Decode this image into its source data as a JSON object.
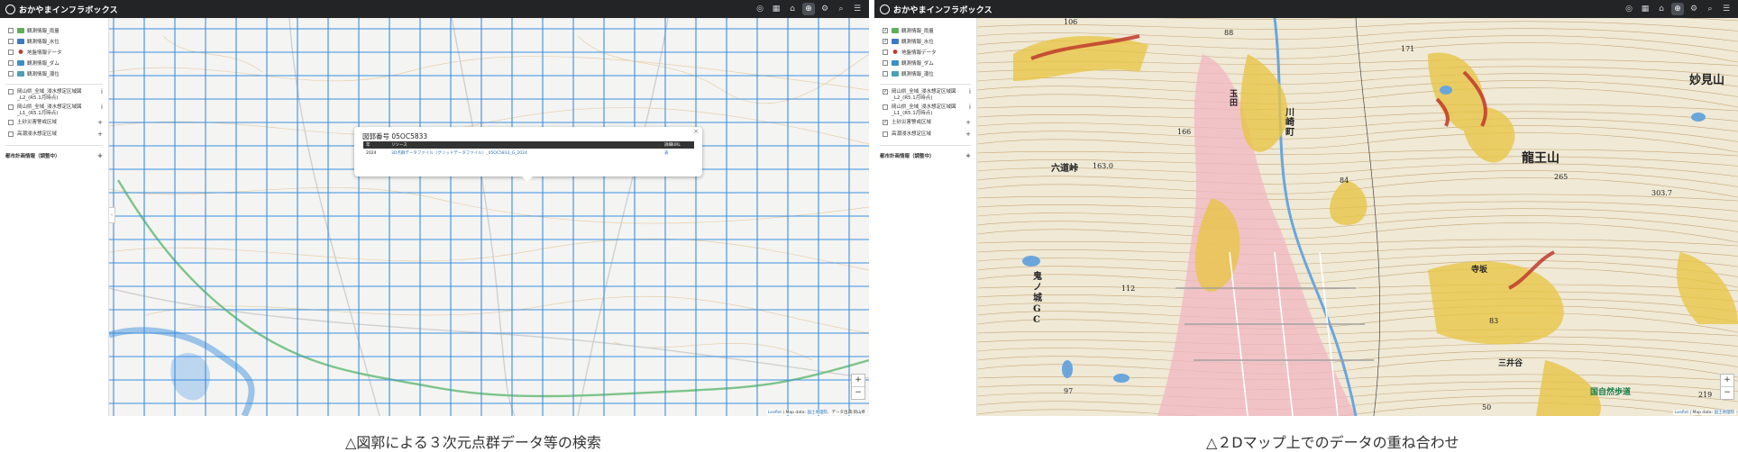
{
  "app": {
    "title": "おかやまインフラボックス"
  },
  "toolbar_icons": [
    "layers-icon",
    "grid-icon",
    "pin-icon",
    "locate-icon",
    "settings-icon",
    "search-icon",
    "stack-icon"
  ],
  "left_panel": {
    "sidebar": {
      "layers_top": [
        {
          "label": "観測情報_雨量",
          "checked": false,
          "icon": "rain-icon",
          "color": "#5fae5a"
        },
        {
          "label": "観測情報_水位",
          "checked": false,
          "icon": "water-level-icon",
          "color": "#3d78c8"
        },
        {
          "label": "地盤情報データ",
          "checked": false,
          "icon": "ground-pin-icon",
          "color": "#c0392b"
        },
        {
          "label": "観測情報_ダム",
          "checked": false,
          "icon": "dam-icon",
          "color": "#3d8ec8"
        },
        {
          "label": "観測情報_潮位",
          "checked": false,
          "icon": "tide-icon",
          "color": "#4aa0b4"
        }
      ],
      "layers_bottom": [
        {
          "label": "岡山県_全域_浸水想定区域図_L2_(R5.1月時点)",
          "checked": false,
          "mark": "i"
        },
        {
          "label": "岡山県_全域_浸水想定区域図_L1_(R5.1月時点)",
          "checked": false,
          "mark": "i"
        },
        {
          "label": "土砂災害警戒区域",
          "checked": false,
          "mark": "+"
        },
        {
          "label": "高潮浸水想定区域",
          "checked": false,
          "mark": "+"
        }
      ],
      "section": {
        "label": "都市計画情報（調整中）",
        "mark": "+"
      }
    },
    "popup": {
      "title": "図郭番号 05OC5833",
      "close": "×",
      "headers": [
        "年",
        "リソース",
        "詳細URL"
      ],
      "rows": [
        [
          "2024",
          "3D点群データファイル（グリッドデータファイル）_05OC5833_G_2024",
          "表"
        ]
      ]
    },
    "zoom": {
      "plus": "+",
      "minus": "−"
    },
    "attribution": {
      "leaflet": "Leaflet",
      "rest": " | Map data: ",
      "source": "国土地理院",
      "suffix": "、データ出典:岡山県"
    },
    "map_labels": []
  },
  "right_panel": {
    "sidebar": {
      "layers_top": [
        {
          "label": "観測情報_雨量",
          "checked": true,
          "icon": "rain-icon",
          "color": "#5fae5a"
        },
        {
          "label": "観測情報_水位",
          "checked": true,
          "icon": "water-level-icon",
          "color": "#3d78c8"
        },
        {
          "label": "地盤情報データ",
          "checked": false,
          "icon": "ground-pin-icon",
          "color": "#c0392b"
        },
        {
          "label": "観測情報_ダム",
          "checked": false,
          "icon": "dam-icon",
          "color": "#3d8ec8"
        },
        {
          "label": "観測情報_潮位",
          "checked": false,
          "icon": "tide-icon",
          "color": "#4aa0b4"
        }
      ],
      "layers_bottom": [
        {
          "label": "岡山県_全域_浸水想定区域図_L2_(R5.1月時点)",
          "checked": true,
          "mark": "i"
        },
        {
          "label": "岡山県_全域_浸水想定区域図_L1_(R5.1月時点)",
          "checked": false,
          "mark": "i"
        },
        {
          "label": "土砂災害警戒区域",
          "checked": true,
          "mark": "+"
        },
        {
          "label": "高潮浸水想定区域",
          "checked": false,
          "mark": "+"
        }
      ],
      "section": {
        "label": "都市計画情報（調整中）",
        "mark": "+"
      }
    },
    "zoom": {
      "plus": "+",
      "minus": "−"
    },
    "attribution": {
      "leaflet": "Leaflet",
      "rest": " | Map data: ",
      "source": "国土地理院",
      "suffix": ""
    },
    "map_labels": [
      "妙見山",
      "龍王山",
      "六道峠",
      "鬼ノ城GC",
      "川崎町",
      "三井谷",
      "玉田",
      "寺坂",
      "国自然歩道",
      "265",
      "303.7",
      "163.0",
      "166",
      "171",
      "112",
      "84",
      "83",
      "97",
      "50",
      "219",
      "106",
      "88"
    ]
  },
  "captions": {
    "left": "△図郭による３次元点群データ等の検索",
    "right": "△２Dマップ上でのデータの重ね合わせ"
  },
  "colors": {
    "topbar": "#222426",
    "grid": "#3a8fe0",
    "flood": "#f2b6c2",
    "landslide": "#e8c547",
    "danger": "#c0392b"
  }
}
